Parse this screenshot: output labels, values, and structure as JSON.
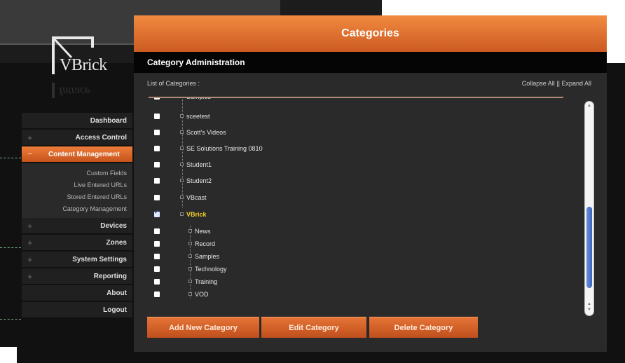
{
  "logo": {
    "text": "VBrick",
    "reflection": "Intrace"
  },
  "sidebar": {
    "items": [
      {
        "label": "Dashboard",
        "has_plus": false,
        "active": false
      },
      {
        "label": "Access Control",
        "has_plus": true,
        "active": false
      },
      {
        "label": "Content Management",
        "has_plus": true,
        "active": true
      },
      {
        "label": "Devices",
        "has_plus": true,
        "active": false
      },
      {
        "label": "Zones",
        "has_plus": true,
        "active": false
      },
      {
        "label": "System Settings",
        "has_plus": true,
        "active": false
      },
      {
        "label": "Reporting",
        "has_plus": true,
        "active": false
      },
      {
        "label": "About",
        "has_plus": false,
        "active": false
      },
      {
        "label": "Logout",
        "has_plus": false,
        "active": false
      }
    ],
    "subitems": [
      "Custom Fields",
      "Live Entered URLs",
      "Stored Entered URLs",
      "Category Management"
    ],
    "plus_symbol": "+",
    "active_symbol": "−"
  },
  "panel": {
    "title": "Categories",
    "subtitle": "Category Administration",
    "list_label": "List of Categories :",
    "collapse_all": "Collapse All",
    "separator": "||",
    "expand_all": "Expand All"
  },
  "categories": [
    {
      "label": "Samples",
      "level": 0,
      "checked": false
    },
    {
      "label": "sceetest",
      "level": 0,
      "checked": false
    },
    {
      "label": "Scott's Videos",
      "level": 0,
      "checked": false
    },
    {
      "label": "SE Solutions Training 0810",
      "level": 0,
      "checked": false
    },
    {
      "label": "Student1",
      "level": 0,
      "checked": false
    },
    {
      "label": "Student2",
      "level": 0,
      "checked": false
    },
    {
      "label": "VBcast",
      "level": 0,
      "checked": false
    },
    {
      "label": "VBrick",
      "level": 0,
      "checked": true,
      "highlight": true
    },
    {
      "label": "News",
      "level": 1,
      "checked": false
    },
    {
      "label": "Record",
      "level": 1,
      "checked": false
    },
    {
      "label": "Samples",
      "level": 1,
      "checked": false
    },
    {
      "label": "Technology",
      "level": 1,
      "checked": false
    },
    {
      "label": "Training",
      "level": 1,
      "checked": false
    },
    {
      "label": "VOD",
      "level": 1,
      "checked": false
    }
  ],
  "scroll_position_fraction": 0.55,
  "buttons": {
    "add": "Add New Category",
    "edit": "Edit Category",
    "delete": "Delete Category"
  },
  "colors": {
    "accent_orange": "#e06a2c",
    "highlight_yellow": "#f2d227",
    "scroll_blue": "#4a73cc"
  }
}
